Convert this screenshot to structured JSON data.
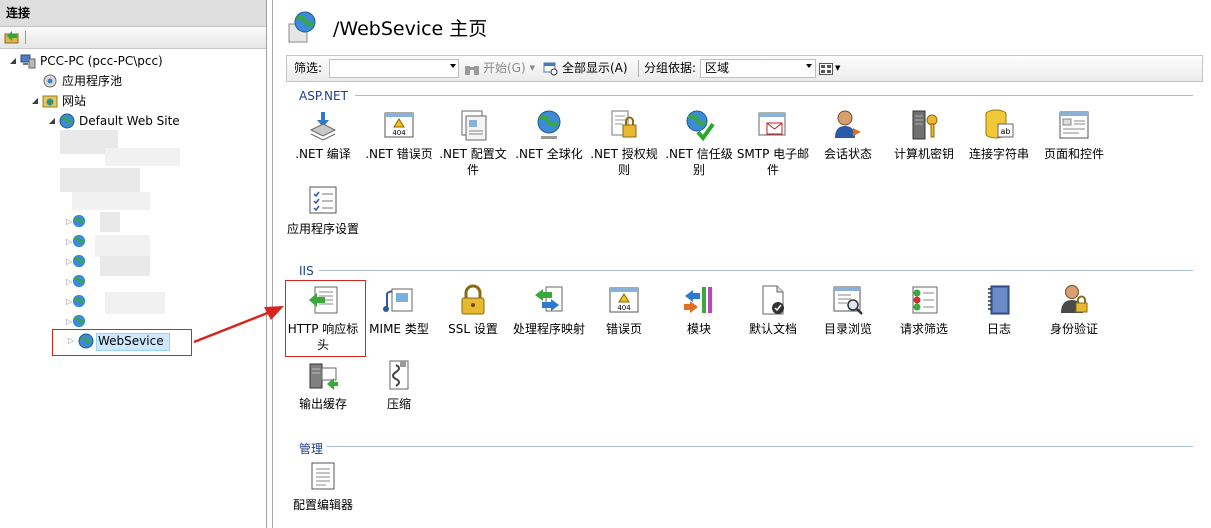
{
  "connections": {
    "header": "连接",
    "tree": {
      "server": "PCC-PC (pcc-PC\\pcc)",
      "app_pools": "应用程序池",
      "sites": "网站",
      "default_site": "Default Web Site",
      "selected_site": "WebSevice"
    }
  },
  "main": {
    "title": "/WebSevice 主页",
    "filter": {
      "label": "筛选:",
      "go": "开始(G)",
      "show_all": "全部显示(A)",
      "group_by_label": "分组依据:",
      "group_by_value": "区域"
    },
    "groups": {
      "aspnet": {
        "title": "ASP.NET",
        "items": [
          ".NET 编译",
          ".NET 错误页",
          ".NET 配置文件",
          ".NET 全球化",
          ".NET 授权规则",
          ".NET 信任级别",
          "SMTP 电子邮件",
          "会话状态",
          "计算机密钥",
          "连接字符串",
          "页面和控件",
          "应用程序设置"
        ]
      },
      "iis": {
        "title": "IIS",
        "items": [
          "HTTP 响应标头",
          "MIME 类型",
          "SSL 设置",
          "处理程序映射",
          "错误页",
          "模块",
          "默认文档",
          "目录浏览",
          "请求筛选",
          "日志",
          "身份验证",
          "输出缓存",
          "压缩"
        ]
      },
      "management": {
        "title": "管理",
        "items": [
          "配置编辑器"
        ]
      }
    }
  },
  "colors": {
    "annotation_red": "#d9231f",
    "group_title": "#1c3f8a",
    "selection": "#cde8ff"
  }
}
